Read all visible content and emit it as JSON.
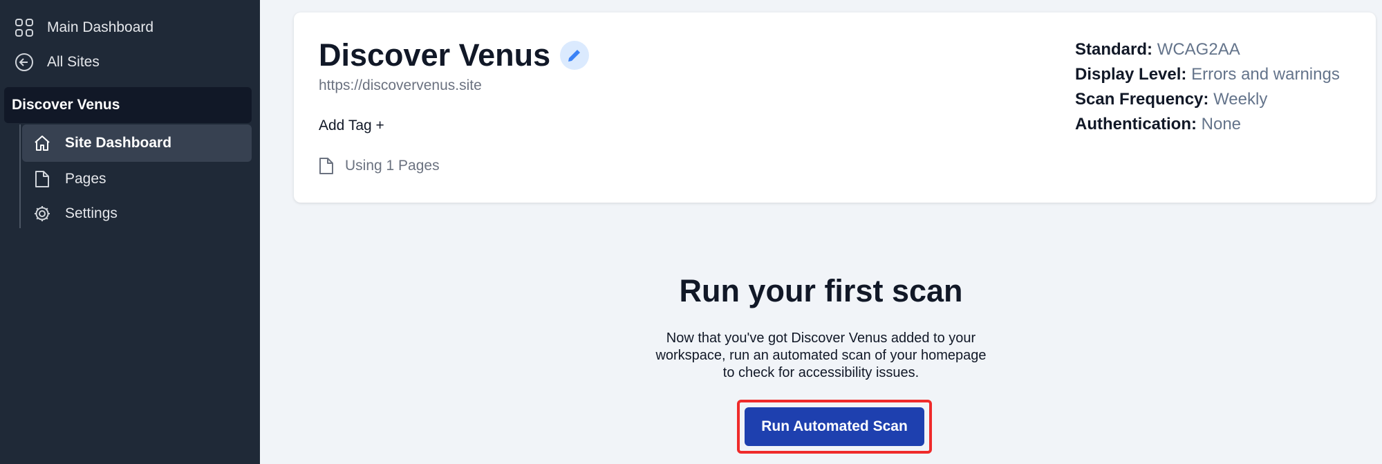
{
  "sidebar": {
    "main_dashboard": "Main Dashboard",
    "all_sites": "All Sites",
    "site_name": "Discover Venus",
    "items": [
      {
        "label": "Site Dashboard",
        "icon": "home-icon",
        "active": true
      },
      {
        "label": "Pages",
        "icon": "page-icon"
      },
      {
        "label": "Settings",
        "icon": "gear-icon"
      }
    ]
  },
  "site": {
    "title": "Discover Venus",
    "url": "https://discovervenus.site",
    "add_tag": "Add Tag +",
    "pages_note": "Using 1 Pages"
  },
  "meta": {
    "standard_label": "Standard:",
    "standard_value": "WCAG2AA",
    "display_label": "Display Level:",
    "display_value": "Errors and warnings",
    "frequency_label": "Scan Frequency:",
    "frequency_value": "Weekly",
    "auth_label": "Authentication:",
    "auth_value": "None"
  },
  "empty_state": {
    "heading": "Run your first scan",
    "line1": "Now that you've got Discover Venus added to your",
    "line2": "workspace, run an automated scan of your homepage",
    "line3": "to check for accessibility issues.",
    "button": "Run Automated Scan"
  },
  "colors": {
    "sidebar_bg": "#1f2937",
    "accent": "#1e40af",
    "highlight": "#ef2b2b"
  }
}
